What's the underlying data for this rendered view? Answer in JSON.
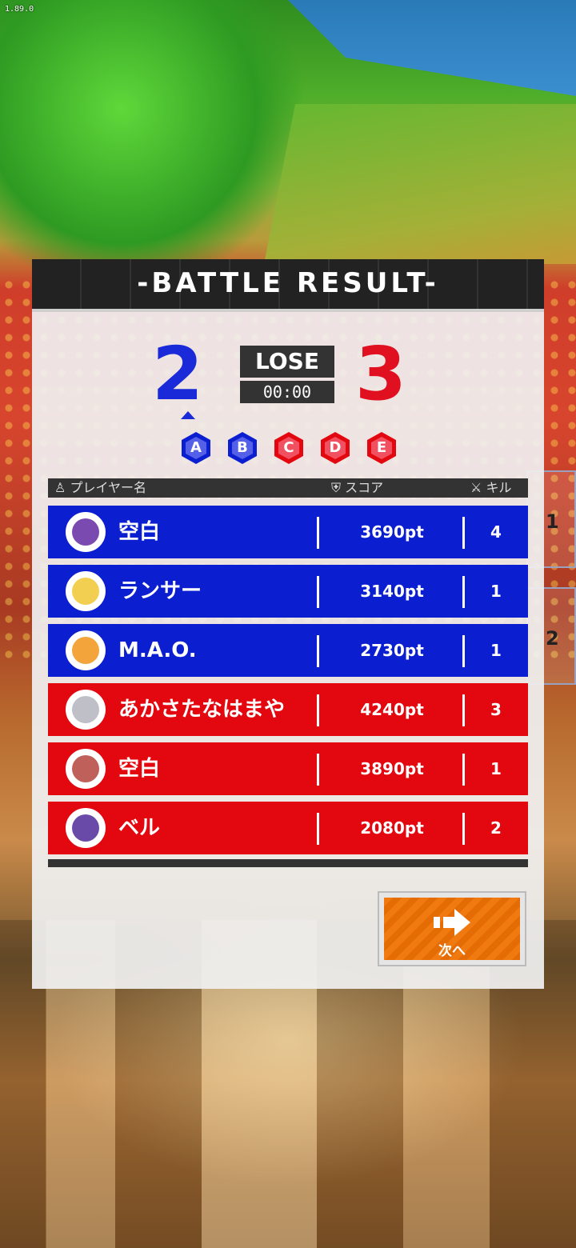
{
  "version": "1.89.0",
  "panel": {
    "title": "-BATTLE RESULT-",
    "blue_score": "2",
    "red_score": "3",
    "result": "LOSE",
    "time": "00:00"
  },
  "points": [
    {
      "label": "A",
      "team": "blue",
      "color": "#0c1fd0"
    },
    {
      "label": "B",
      "team": "blue",
      "color": "#0c1fd0"
    },
    {
      "label": "C",
      "team": "red",
      "color": "#e3080f"
    },
    {
      "label": "D",
      "team": "red",
      "color": "#e3080f"
    },
    {
      "label": "E",
      "team": "red",
      "color": "#e3080f"
    }
  ],
  "columns": {
    "player": "プレイヤー名",
    "score": "スコア",
    "kill": "キル"
  },
  "players": [
    {
      "name": "空白",
      "score": "3690pt",
      "kills": "4",
      "team": "blue",
      "avatar": "purple-hair-avatar"
    },
    {
      "name": "ランサー",
      "score": "3140pt",
      "kills": "1",
      "team": "blue",
      "avatar": "blonde-avatar"
    },
    {
      "name": "M.A.O.",
      "score": "2730pt",
      "kills": "1",
      "team": "blue",
      "avatar": "orange-hair-avatar"
    },
    {
      "name": "あかさたなはまや",
      "score": "4240pt",
      "kills": "3",
      "team": "red",
      "avatar": "white-robot-avatar"
    },
    {
      "name": "空白",
      "score": "3890pt",
      "kills": "1",
      "team": "red",
      "avatar": "pink-hair-avatar"
    },
    {
      "name": "ベル",
      "score": "2080pt",
      "kills": "2",
      "team": "red",
      "avatar": "purple-mask-avatar"
    }
  ],
  "next_button": {
    "label": "次へ"
  },
  "side_tabs": [
    "1",
    "2"
  ],
  "colors": {
    "blue": "#0c1fd0",
    "red": "#e3080f",
    "accent": "#f07a10"
  }
}
